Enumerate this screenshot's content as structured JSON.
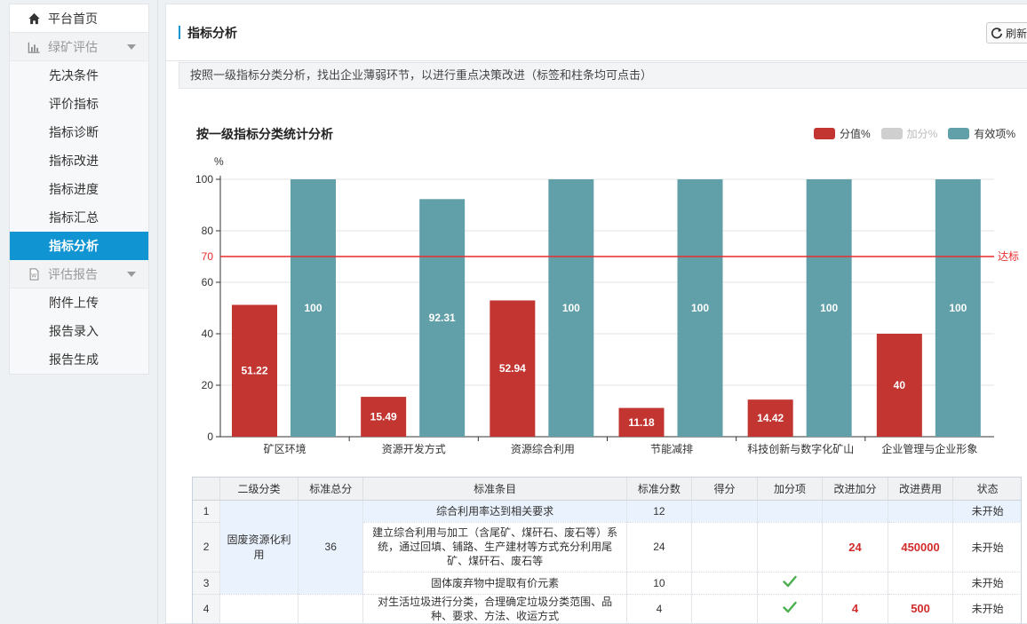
{
  "sidebar": {
    "home": "平台首页",
    "group1": "绿矿评估",
    "items1": [
      "先决条件",
      "评价指标",
      "指标诊断",
      "指标改进",
      "指标进度",
      "指标汇总",
      "指标分析"
    ],
    "group2": "评估报告",
    "items2": [
      "附件上传",
      "报告录入",
      "报告生成"
    ]
  },
  "header": {
    "title": "指标分析",
    "refresh": "刷新"
  },
  "notice": "按照一级指标分类分析，找出企业薄弱环节，以进行重点决策改进（标签和柱条均可点击）",
  "colors": {
    "score": "#c23531",
    "bonus": "#cfcfcf",
    "valid": "#61a0a8",
    "accent": "#1195d2",
    "target": "#e82c2c"
  },
  "chart_data": {
    "type": "bar",
    "title": "按一级指标分类统计分析",
    "ylabel": "%",
    "ylim": [
      0,
      100
    ],
    "yticks": [
      0,
      20,
      40,
      60,
      80,
      100
    ],
    "categories": [
      "矿区环境",
      "资源开发方式",
      "资源综合利用",
      "节能减排",
      "科技创新与数字化矿山",
      "企业管理与企业形象"
    ],
    "series": [
      {
        "name": "分值%",
        "values": [
          51.22,
          15.49,
          52.94,
          11.18,
          14.42,
          40
        ]
      },
      {
        "name": "加分%",
        "values": []
      },
      {
        "name": "有效项%",
        "values": [
          100,
          92.31,
          100,
          100,
          100,
          100
        ]
      }
    ],
    "markline": {
      "value": 70,
      "label": "达标"
    },
    "legend_position": "top-right"
  },
  "table": {
    "headers": [
      "",
      "二级分类",
      "标准总分",
      "标准条目",
      "标准分数",
      "得分",
      "加分项",
      "改进加分",
      "改进费用",
      "状态"
    ],
    "group_name": "固废资源化利用",
    "group_total": "36",
    "rows": [
      {
        "idx": "1",
        "item": "综合利用率达到相关要求",
        "std": "12",
        "score": "",
        "bonus": false,
        "imp": "",
        "cost": "",
        "status": "未开始"
      },
      {
        "idx": "2",
        "item": "建立综合利用与加工（含尾矿、煤矸石、废石等）系统，通过回填、铺路、生产建材等方式充分利用尾矿、煤矸石、废石等",
        "std": "24",
        "score": "",
        "bonus": false,
        "imp": "24",
        "cost": "450000",
        "status": "未开始"
      },
      {
        "idx": "3",
        "item": "固体废弃物中提取有价元素",
        "std": "10",
        "score": "",
        "bonus": true,
        "imp": "",
        "cost": "",
        "status": "未开始"
      },
      {
        "idx": "4",
        "item": "对生活垃圾进行分类，合理确定垃圾分类范围、品种、要求、方法、收运方式",
        "std": "4",
        "score": "",
        "bonus": true,
        "imp": "4",
        "cost": "500",
        "status": "未开始"
      }
    ]
  }
}
